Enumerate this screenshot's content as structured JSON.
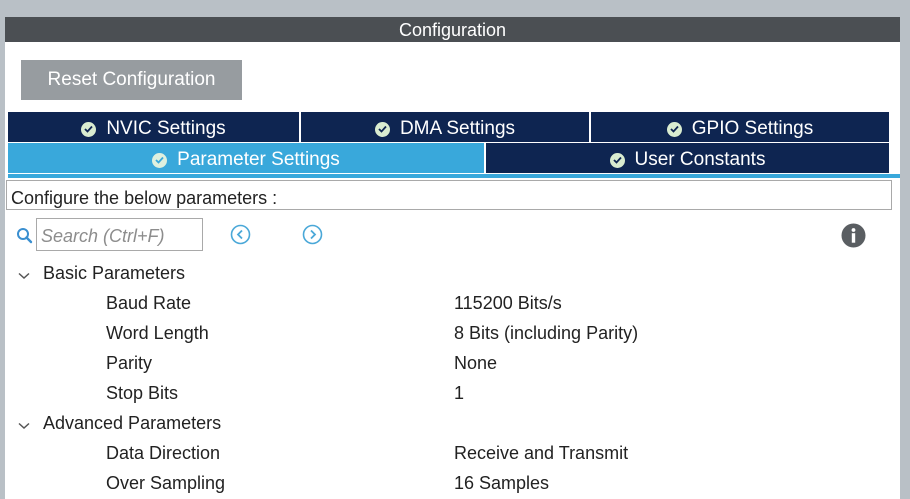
{
  "title": "Configuration",
  "reset_label": "Reset Configuration",
  "tabs": [
    {
      "label": "NVIC Settings"
    },
    {
      "label": "DMA Settings"
    },
    {
      "label": "GPIO Settings"
    },
    {
      "label": "Parameter Settings",
      "active": true
    },
    {
      "label": "User Constants"
    }
  ],
  "description": "Configure the below parameters :",
  "search": {
    "placeholder": "Search (Ctrl+F)"
  },
  "groups": [
    {
      "label": "Basic Parameters",
      "params": [
        {
          "name": "Baud Rate",
          "value": "115200 Bits/s"
        },
        {
          "name": "Word Length",
          "value": "8 Bits (including Parity)"
        },
        {
          "name": "Parity",
          "value": "None"
        },
        {
          "name": "Stop Bits",
          "value": "1"
        }
      ]
    },
    {
      "label": "Advanced Parameters",
      "params": [
        {
          "name": "Data Direction",
          "value": "Receive and Transmit"
        },
        {
          "name": "Over Sampling",
          "value": "16 Samples"
        }
      ]
    }
  ],
  "colors": {
    "title_bar": "#4b4f53",
    "tab_inactive": "#0e2551",
    "tab_active": "#39a8db",
    "reset_button": "#979ca0",
    "nav_icon": "#4aa8d8"
  },
  "icons": {
    "tab_status": "check-circle-icon",
    "search": "search-icon",
    "prev": "chevron-left-circle-icon",
    "next": "chevron-right-circle-icon",
    "info": "info-icon",
    "group_toggle": "chevron-down-icon"
  }
}
